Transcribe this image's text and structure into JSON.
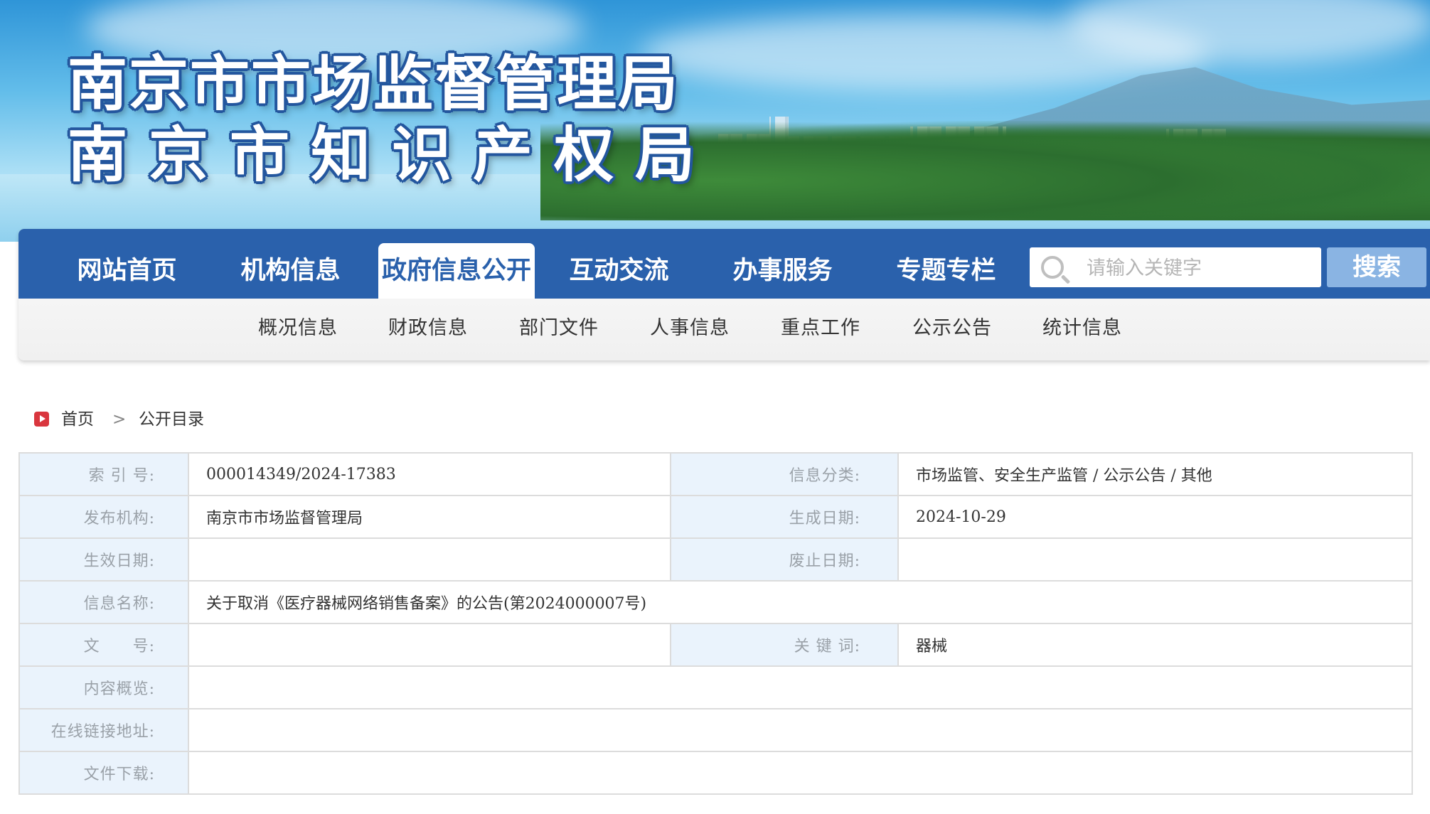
{
  "header": {
    "title_line1": "南京市市场监督管理局",
    "title_line2": "南京市知识产权局"
  },
  "nav": {
    "items": [
      {
        "label": "网站首页",
        "active": false
      },
      {
        "label": "机构信息",
        "active": false
      },
      {
        "label": "政府信息公开",
        "active": true
      },
      {
        "label": "互动交流",
        "active": false
      },
      {
        "label": "办事服务",
        "active": false
      },
      {
        "label": "专题专栏",
        "active": false
      }
    ],
    "search_placeholder": "请输入关键字",
    "search_button": "搜索"
  },
  "subnav": {
    "items": [
      "概况信息",
      "财政信息",
      "部门文件",
      "人事信息",
      "重点工作",
      "公示公告",
      "统计信息"
    ]
  },
  "breadcrumb": {
    "home": "首页",
    "separator": ">",
    "current": "公开目录"
  },
  "info": {
    "index_label": "索 引 号:",
    "index_value": "000014349/2024-17383",
    "category_label": "信息分类:",
    "category_value": "市场监管、安全生产监管 / 公示公告 / 其他",
    "publisher_label": "发布机构:",
    "publisher_value": "南京市市场监督管理局",
    "created_label": "生成日期:",
    "created_value": "2024-10-29",
    "effective_label": "生效日期:",
    "effective_value": "",
    "expire_label": "废止日期:",
    "expire_value": "",
    "name_label": "信息名称:",
    "name_value": "关于取消《医疗器械网络销售备案》的公告(第2024000007号)",
    "docno_label": "文　　号:",
    "docno_value": "",
    "keywords_label": "关 键 词:",
    "keywords_value": "器械",
    "summary_label": "内容概览:",
    "summary_value": "",
    "link_label": "在线链接地址:",
    "link_value": "",
    "download_label": "文件下载:",
    "download_value": ""
  },
  "colors": {
    "nav_blue": "#2a61ac",
    "search_button": "#8ab4e3",
    "label_bg": "#eaf3fc",
    "home_icon": "#d9363e"
  }
}
